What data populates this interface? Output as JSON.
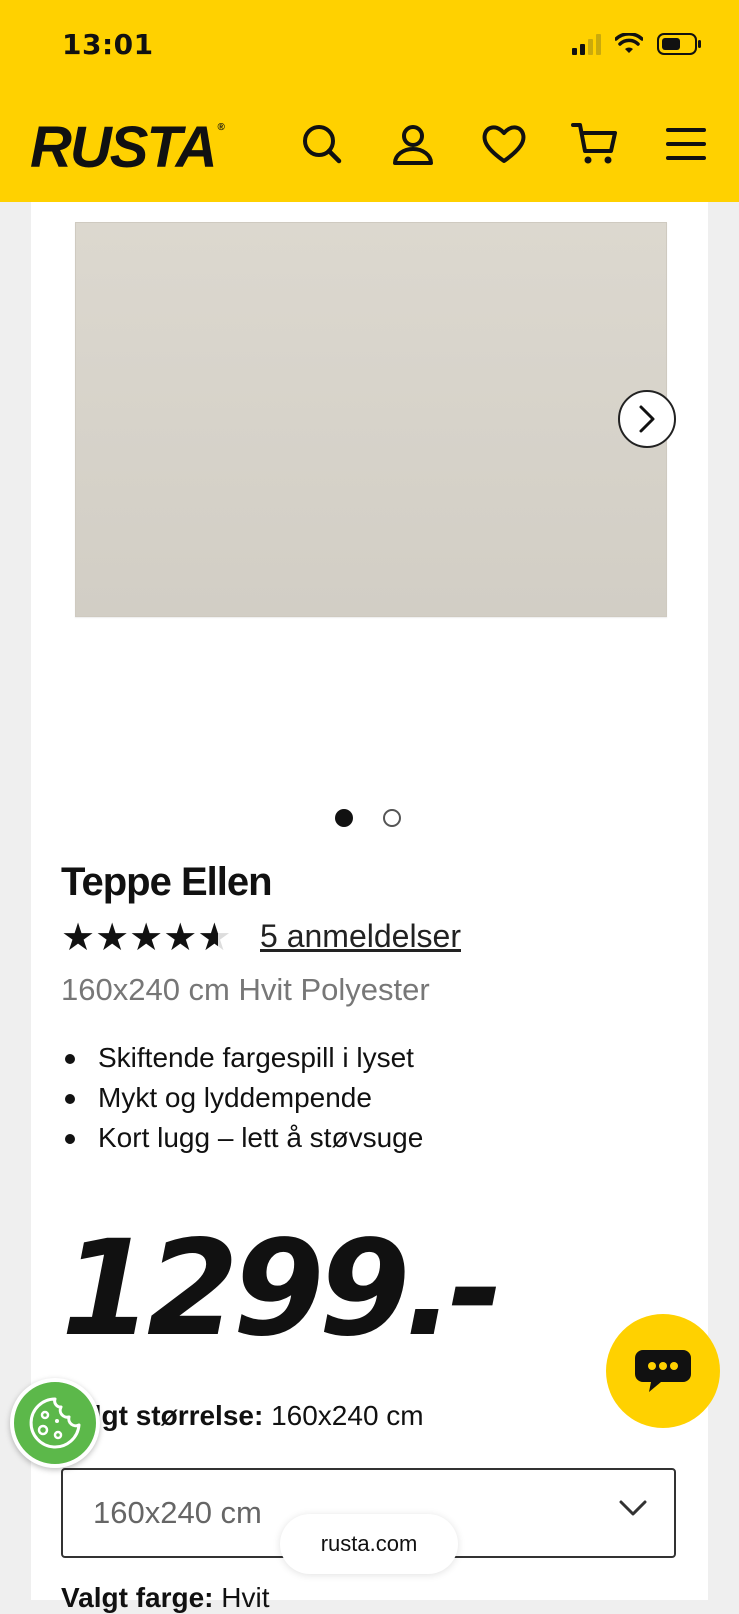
{
  "status_bar": {
    "time": "13:01"
  },
  "header": {
    "logo_text": "RUSTA",
    "brand_color": "#ffd100"
  },
  "carousel": {
    "active_index": 0,
    "count": 2
  },
  "product": {
    "title": "Teppe Ellen",
    "rating": 4.6,
    "reviews_link": "5 anmeldelser",
    "subtitle": "160x240 cm Hvit Polyester",
    "features": [
      "Skiftende fargespill i lyset",
      "Mykt og lyddempende",
      "Kort lugg – lett å støvsuge"
    ],
    "price": "1299.-"
  },
  "size": {
    "label": "Valgt størrelse:",
    "value": "160x240 cm",
    "select_value": "160x240 cm"
  },
  "color": {
    "label": "Valgt farge:",
    "value": "Hvit"
  },
  "browser": {
    "url": "rusta.com"
  }
}
